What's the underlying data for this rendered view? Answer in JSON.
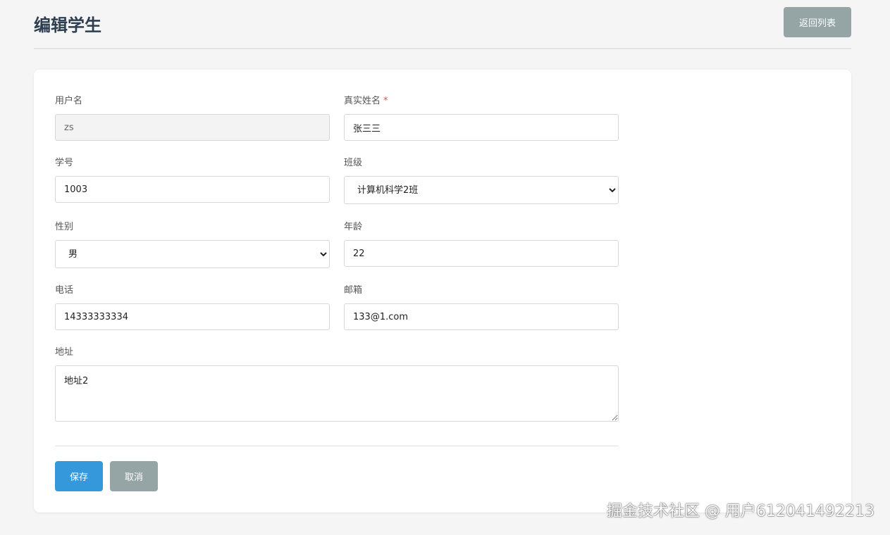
{
  "header": {
    "title": "编辑学生",
    "back_label": "返回列表"
  },
  "form": {
    "username": {
      "label": "用户名",
      "value": "zs"
    },
    "real_name": {
      "label": "真实姓名",
      "required_mark": "*",
      "value": "张三三"
    },
    "student_no": {
      "label": "学号",
      "value": "1003"
    },
    "class": {
      "label": "班级",
      "selected": "计算机科学2班"
    },
    "gender": {
      "label": "性别",
      "selected": "男"
    },
    "age": {
      "label": "年龄",
      "value": "22"
    },
    "phone": {
      "label": "电话",
      "value": "14333333334"
    },
    "email": {
      "label": "邮箱",
      "value": "133@1.com"
    },
    "address": {
      "label": "地址",
      "value": "地址2"
    }
  },
  "actions": {
    "save_label": "保存",
    "cancel_label": "取消"
  },
  "watermark": "掘金技术社区 @ 用户612041492213",
  "colors": {
    "primary": "#3498db",
    "secondary": "#95a5a6",
    "required": "#e74c3c",
    "title": "#2c3e50"
  },
  "icons": {
    "select_arrow": "chevron-down-icon"
  }
}
